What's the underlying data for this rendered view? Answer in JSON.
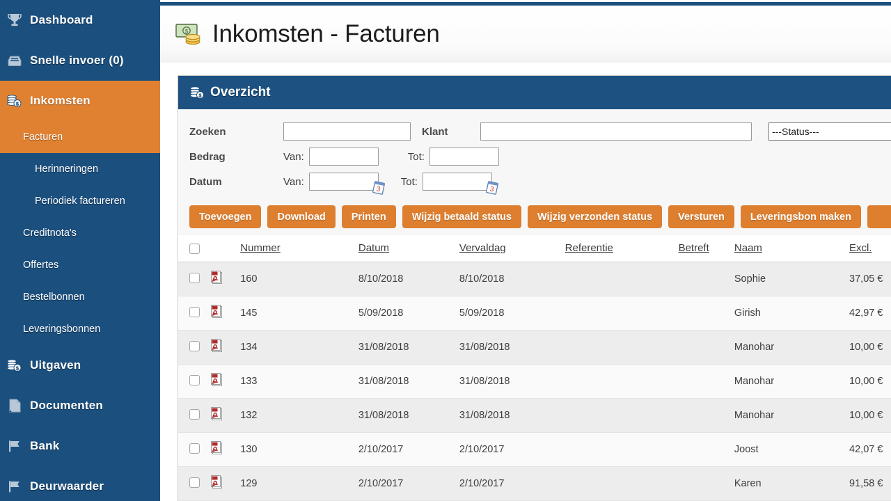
{
  "sidebar": {
    "items": [
      {
        "label": "Dashboard",
        "icon": "trophy-icon",
        "level": "top",
        "active": false
      },
      {
        "label": "Snelle invoer (0)",
        "icon": "inbox-icon",
        "level": "top",
        "active": false
      },
      {
        "label": "Inkomsten",
        "icon": "coins-icon",
        "level": "top",
        "active": true
      },
      {
        "label": "Facturen",
        "icon": "",
        "level": "sub1",
        "active": true
      },
      {
        "label": "Herinneringen",
        "icon": "",
        "level": "sub2",
        "active": false
      },
      {
        "label": "Periodiek factureren",
        "icon": "",
        "level": "sub2",
        "active": false
      },
      {
        "label": "Creditnota's",
        "icon": "",
        "level": "sub1",
        "active": false
      },
      {
        "label": "Offertes",
        "icon": "",
        "level": "sub1",
        "active": false
      },
      {
        "label": "Bestelbonnen",
        "icon": "",
        "level": "sub1",
        "active": false
      },
      {
        "label": "Leveringsbonnen",
        "icon": "",
        "level": "sub1",
        "active": false
      },
      {
        "label": "Uitgaven",
        "icon": "coins-icon",
        "level": "top",
        "active": false
      },
      {
        "label": "Documenten",
        "icon": "document-icon",
        "level": "top",
        "active": false
      },
      {
        "label": "Bank",
        "icon": "flag-icon",
        "level": "top",
        "active": false
      },
      {
        "label": "Deurwaarder",
        "icon": "flag-icon",
        "level": "top",
        "active": false
      }
    ]
  },
  "page": {
    "title": "Inkomsten - Facturen",
    "title_icon": "money-icon"
  },
  "panel": {
    "title": "Overzicht",
    "icon": "coins-icon"
  },
  "filters": {
    "zoeken_label": "Zoeken",
    "zoeken_value": "",
    "zoeken_placeholder": "",
    "klant_label": "Klant",
    "klant_value": "",
    "klant_placeholder": "",
    "status_selected": "---Status---",
    "status_options": [
      "---Status---"
    ],
    "bedrag_label": "Bedrag",
    "bedrag_van_label": "Van:",
    "bedrag_van_value": "",
    "bedrag_tot_label": "Tot:",
    "bedrag_tot_value": "",
    "datum_label": "Datum",
    "datum_van_label": "Van:",
    "datum_van_value": "",
    "datum_tot_label": "Tot:",
    "datum_tot_value": "",
    "calendar_icon": "calendar-icon"
  },
  "toolbar": {
    "buttons": [
      "Toevoegen",
      "Download",
      "Printen",
      "Wijzig betaald status",
      "Wijzig verzonden status",
      "Versturen",
      "Leveringsbon maken",
      ""
    ]
  },
  "table": {
    "columns": [
      {
        "key": "check",
        "label": "",
        "cls": "c-chk"
      },
      {
        "key": "pdf",
        "label": "",
        "cls": "c-pdf"
      },
      {
        "key": "nummer",
        "label": "Nummer",
        "cls": "c-num"
      },
      {
        "key": "datum",
        "label": "Datum",
        "cls": "c-dat"
      },
      {
        "key": "verval",
        "label": "Vervaldag",
        "cls": "c-verv"
      },
      {
        "key": "ref",
        "label": "Referentie",
        "cls": "c-ref"
      },
      {
        "key": "betr",
        "label": "Betreft",
        "cls": "c-bet"
      },
      {
        "key": "naam",
        "label": "Naam",
        "cls": "c-naam"
      },
      {
        "key": "excl",
        "label": "Excl.",
        "cls": "c-exc"
      }
    ],
    "rows": [
      {
        "nummer": "160",
        "datum": "8/10/2018",
        "verval": "8/10/2018",
        "ref": "",
        "betr": "",
        "naam": "Sophie",
        "excl": "37,05 €"
      },
      {
        "nummer": "145",
        "datum": "5/09/2018",
        "verval": "5/09/2018",
        "ref": "",
        "betr": "",
        "naam": "Girish",
        "excl": "42,97 €"
      },
      {
        "nummer": "134",
        "datum": "31/08/2018",
        "verval": "31/08/2018",
        "ref": "",
        "betr": "",
        "naam": "Manohar",
        "excl": "10,00 €"
      },
      {
        "nummer": "133",
        "datum": "31/08/2018",
        "verval": "31/08/2018",
        "ref": "",
        "betr": "",
        "naam": "Manohar",
        "excl": "10,00 €"
      },
      {
        "nummer": "132",
        "datum": "31/08/2018",
        "verval": "31/08/2018",
        "ref": "",
        "betr": "",
        "naam": "Manohar",
        "excl": "10,00 €"
      },
      {
        "nummer": "130",
        "datum": "2/10/2017",
        "verval": "2/10/2017",
        "ref": "",
        "betr": "",
        "naam": "Joost",
        "excl": "42,07 €"
      },
      {
        "nummer": "129",
        "datum": "2/10/2017",
        "verval": "2/10/2017",
        "ref": "",
        "betr": "",
        "naam": "Karen",
        "excl": "91,58 €"
      }
    ],
    "row_icon": "pdf-icon"
  },
  "colors": {
    "sidebar_bg": "#1b4f7e",
    "accent_orange": "#e08131",
    "button_orange": "#dd7f2f",
    "panel_header": "#1d5181",
    "row_odd": "#ededed",
    "row_even": "#fafafa"
  }
}
